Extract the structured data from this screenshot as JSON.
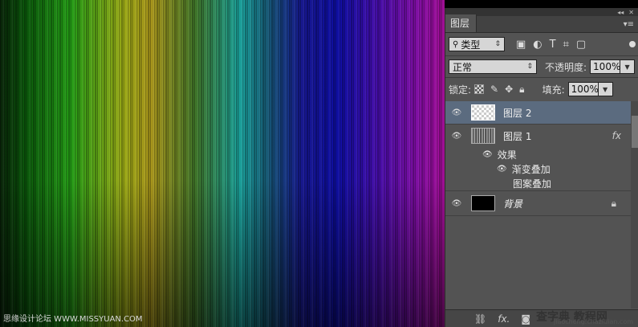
{
  "panel": {
    "tab_label": "图层",
    "filter_kind": "类型",
    "filter_search_icon": "search-icon",
    "blend_mode": "正常",
    "opacity_label": "不透明度:",
    "opacity_value": "100%",
    "lock_label": "锁定:",
    "fill_label": "填充:",
    "fill_value": "100%"
  },
  "layers": [
    {
      "name": "图层 2",
      "selected": true,
      "thumb": "transparent"
    },
    {
      "name": "图层 1",
      "selected": false,
      "thumb": "stripes",
      "fx": "fx",
      "effects_label": "效果",
      "effects": [
        "渐变叠加",
        "图案叠加"
      ]
    },
    {
      "name": "背景",
      "selected": false,
      "thumb": "black",
      "locked": true
    }
  ],
  "watermark": {
    "left": "思缘设计论坛 WWW.MISSYUAN.COM",
    "right": "查字典 教程网",
    "right_url": "jiaocheng.chazidian.com"
  },
  "colors": {
    "panel_bg": "#535353",
    "selected_layer": "#5b6b7f"
  }
}
